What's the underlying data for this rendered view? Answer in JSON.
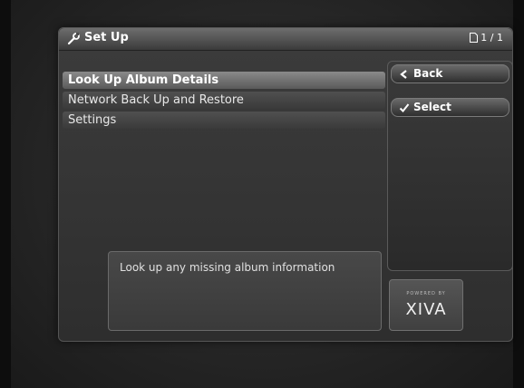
{
  "header": {
    "title": "Set Up",
    "page_indicator": "1 / 1"
  },
  "menu": {
    "items": [
      {
        "label": "Look Up Album Details",
        "selected": true
      },
      {
        "label": "Network Back Up and Restore",
        "selected": false
      },
      {
        "label": "Settings",
        "selected": false
      }
    ]
  },
  "sidebar": {
    "back_label": "Back",
    "select_label": "Select"
  },
  "description": {
    "text": "Look up any missing album information"
  },
  "branding": {
    "powered_by": "POWERED BY",
    "logo": "XIVA"
  }
}
